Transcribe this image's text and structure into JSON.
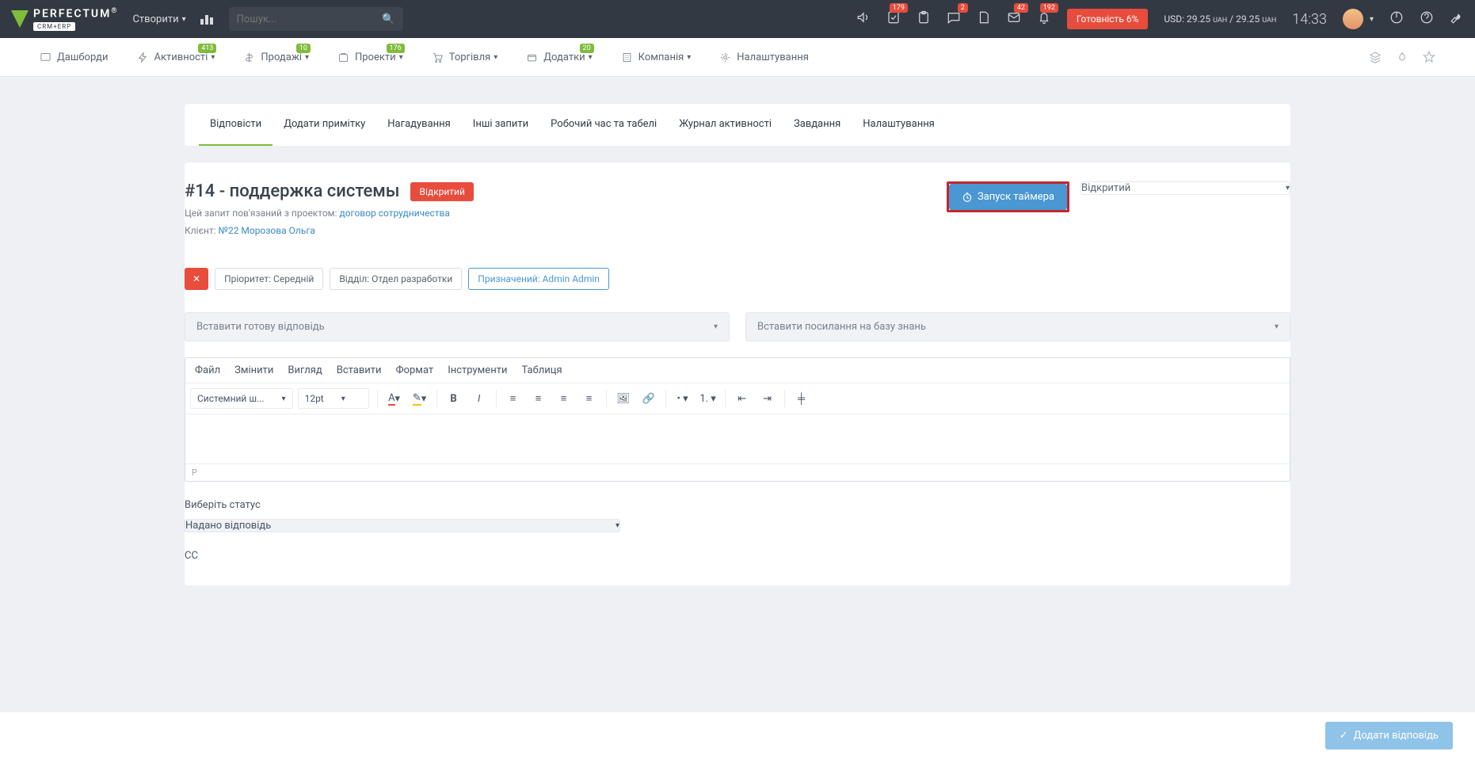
{
  "topbar": {
    "logo_text": "PERFECTUM",
    "logo_sub": "CRM+ERP",
    "create": "Створити",
    "search_placeholder": "Пошук...",
    "badges": {
      "b1": "179",
      "b2": "2",
      "b3": "42",
      "b4": "192"
    },
    "readiness": "Готовність 6%",
    "usd_left": "USD: 29.25",
    "usd_left_u": "UAH",
    "usd_right": "29.25",
    "usd_right_u": "UAH",
    "time": "14:33"
  },
  "nav": {
    "dashboards": "Дашборди",
    "activities": "Активності",
    "activities_b": "413",
    "sales": "Продажі",
    "sales_b": "10",
    "projects": "Проекти",
    "projects_b": "176",
    "trade": "Торгівля",
    "addons": "Додатки",
    "addons_b": "20",
    "company": "Компанія",
    "settings": "Налаштування"
  },
  "tabs": {
    "reply": "Відповісти",
    "note": "Додати примітку",
    "remind": "Нагадування",
    "other": "Інші запити",
    "worktime": "Робочий час та табелі",
    "journal": "Журнал активності",
    "tasks": "Завдання",
    "opts": "Налаштування"
  },
  "ticket": {
    "title": "#14 - поддержка системы",
    "badge": "Відкритий",
    "meta1": "Цей запит пов'язаний з проектом: ",
    "meta1_link": "договор сотрудничества",
    "meta2": "Клієнт: ",
    "meta2_link": "№22 Морозова Ольга",
    "timer": "Запуск таймера",
    "status_sel": "Відкритий"
  },
  "chips": {
    "priority": "Пріоритет: Середній",
    "dept": "Відділ: Отдел разработки",
    "assigned": "Призначений: Admin Admin"
  },
  "dd": {
    "reply": "Вставити готову відповідь",
    "kb": "Вставити посилання на базу знань"
  },
  "editor_menu": {
    "file": "Файл",
    "edit": "Змінити",
    "view": "Вигляд",
    "insert": "Вставити",
    "format": "Формат",
    "tools": "Інструменти",
    "table": "Таблиця"
  },
  "editor_tb": {
    "font": "Системний ш...",
    "size": "12pt",
    "status": "P"
  },
  "status_field": {
    "label": "Виберіть статус",
    "value": "Надано відповідь"
  },
  "cc": "CC",
  "footer_btn": "Додати відповідь"
}
